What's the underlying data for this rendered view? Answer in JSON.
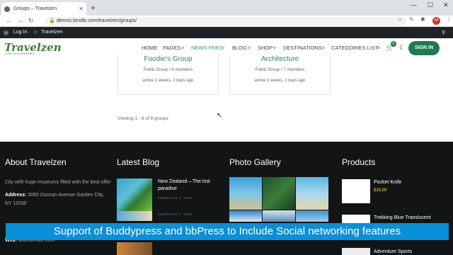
{
  "browser": {
    "tab_title": "Groups – Travelzen",
    "url": "demos.brndle.com/travelzen/groups/",
    "profile_initial": "M"
  },
  "adminbar": {
    "login": "Log In",
    "site": "Travelzen"
  },
  "header": {
    "logo": "Travelzen",
    "tagline": "LIFE IS A JOURNEY",
    "menu": [
      "HOME",
      "PAGES",
      "NEWS FEED",
      "BLOG",
      "SHOP",
      "DESTINATIONS",
      "CATEGORIES LIST"
    ],
    "cart_count": "0",
    "signin": "SIGN IN"
  },
  "groups": [
    {
      "name": "Foodie's Group",
      "meta": "Public Group / 4 members",
      "active": "active 2 weeks, 2 days ago"
    },
    {
      "name": "Architecture",
      "meta": "Public Group / 7 members",
      "active": "active 2 weeks, 2 days ago"
    }
  ],
  "viewing": "Viewing 1 - 8 of 8 groups",
  "footer": {
    "about": {
      "title": "About Travelzen",
      "text": "City with huge museums filled with the best offer",
      "address_label": "Address:",
      "address": "3060 Duncan Avenue Garden City, NY 11530",
      "web_label": "Web:",
      "web": "www.brndle.com"
    },
    "blog": {
      "title": "Latest Blog",
      "post_title": "New Zealand – The lost paradise",
      "post_date": "FEBRUARY 7, 2020",
      "post2_date": "FEBRUARY 7, 2020"
    },
    "gallery": {
      "title": "Photo Gallery"
    },
    "products": {
      "title": "Products",
      "items": [
        {
          "name": "Pocket Knife",
          "price": "$15.00"
        },
        {
          "name": "Trekking Blue Translucent"
        },
        {
          "name": "Adventure Sports"
        }
      ]
    }
  },
  "caption": "Support of Buddypress and bbPress to Include Social networking features"
}
